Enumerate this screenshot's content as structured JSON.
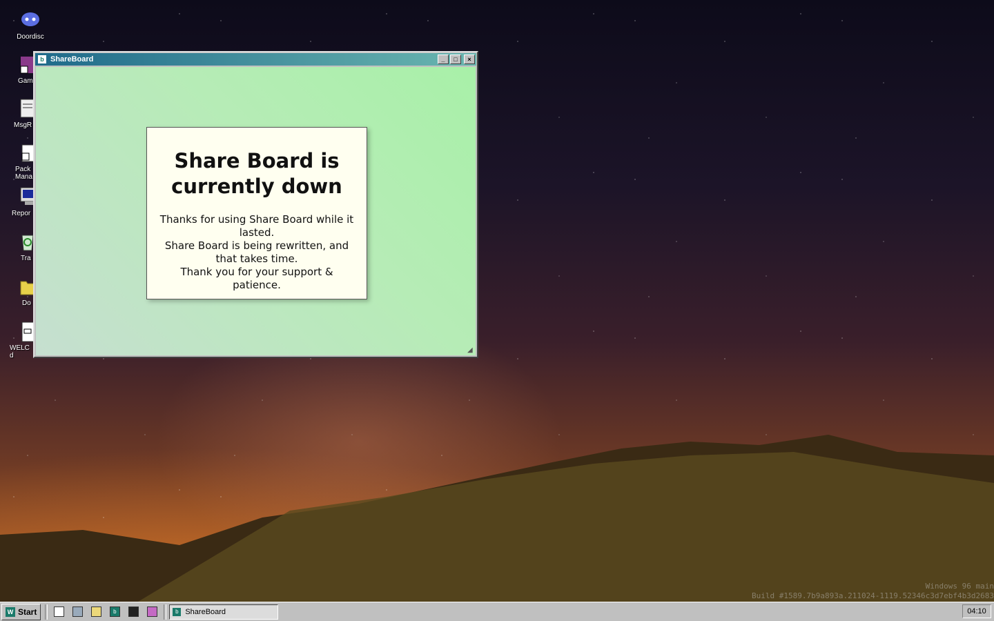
{
  "desktop": {
    "icons": [
      {
        "label": "Doordisc",
        "icon": "discord-icon"
      },
      {
        "label": "Game",
        "icon": "game-icon"
      },
      {
        "label": "MsgR",
        "icon": "message-icon"
      },
      {
        "label": "Pack Mana",
        "icon": "package-icon"
      },
      {
        "label": "Repor",
        "icon": "report-icon"
      },
      {
        "label": "Tra",
        "icon": "trash-icon"
      },
      {
        "label": "Do",
        "icon": "folder-icon"
      },
      {
        "label": "WELC d",
        "icon": "document-icon"
      }
    ]
  },
  "window": {
    "title": "ShareBoard",
    "minimize": "_",
    "maximize": "□",
    "close": "×",
    "notice": {
      "heading": "Share Board is currently down",
      "line1": "Thanks for using Share Board while it lasted.",
      "line2": "Share Board is being rewritten, and that takes time.",
      "line3": "Thank you for your support & patience."
    }
  },
  "watermark": {
    "line1": "Windows 96 main",
    "line2": "Build #1589.7b9a893a.211024-1119.52346c3d7ebf4b3d2683"
  },
  "taskbar": {
    "start_label": "Start",
    "quick_launch": [
      "notepad-icon",
      "computer-icon",
      "explorer-icon",
      "shareboard-icon",
      "terminal-icon",
      "book-icon"
    ],
    "task_label": "ShareBoard",
    "clock": "04:10"
  },
  "colors": {
    "titlebar_start": "#1f6a8a",
    "titlebar_end": "#6ab6b0",
    "content_bg": "#b6ecb6",
    "notice_bg": "#fffff0"
  }
}
